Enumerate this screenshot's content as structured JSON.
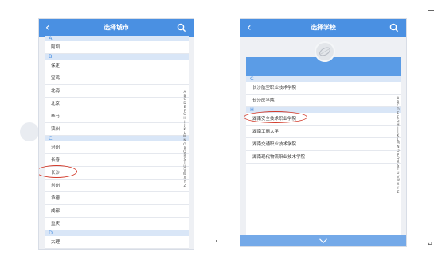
{
  "left_screen": {
    "title": "选择城市",
    "sections": [
      {
        "letter": "A",
        "items": [
          "阿坝"
        ]
      },
      {
        "letter": "B",
        "items": [
          "保定",
          "宝鸡",
          "北海",
          "北京",
          "毕节",
          "滨州"
        ]
      },
      {
        "letter": "C",
        "items": [
          "沧州",
          "长春",
          "长沙",
          "常州",
          "承德",
          "成都",
          "重庆"
        ]
      },
      {
        "letter": "D",
        "items": [
          "大理"
        ]
      }
    ],
    "circled_item": "长沙"
  },
  "right_screen": {
    "title": "选择学校",
    "sections": [
      {
        "letter": "C",
        "items": [
          "长沙航空职业技术学院",
          "长沙医学院"
        ]
      },
      {
        "letter": "H",
        "items": [
          "湖南安全技术职业学院",
          "湖南工商大学",
          "湖南交通职业技术学院",
          "湖南现代物流职业技术学院"
        ]
      }
    ],
    "circled_item": "湖南工商大学"
  },
  "alphabet": [
    "A",
    "B",
    "C",
    "D",
    "E",
    "F",
    "G",
    "H",
    "I",
    "J",
    "K",
    "L",
    "M",
    "N",
    "O",
    "P",
    "Q",
    "R",
    "S",
    "T",
    "U",
    "V",
    "W",
    "X",
    "Y",
    "Z"
  ],
  "icons": {
    "back": "chevron-left-icon",
    "search": "search-icon",
    "bottom": "chevron-down-icon",
    "logo": "school-logo-icon"
  },
  "colors": {
    "header_blue": "#4a90e2",
    "section_bg": "#d9e6f7",
    "annotation_red": "#d23a2a"
  }
}
